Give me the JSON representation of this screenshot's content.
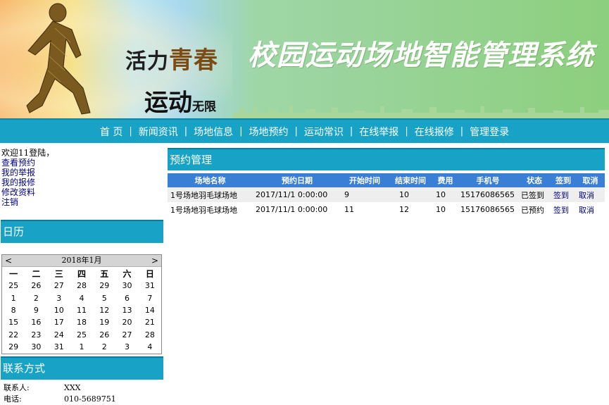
{
  "banner": {
    "slogan_line1_a": "活力",
    "slogan_line1_b": "青春",
    "slogan_line2": "运动",
    "slogan_line2_small": "无限",
    "system_title": "校园运动场地智能管理系统"
  },
  "nav": [
    "首 页",
    "新闻资讯",
    "场地信息",
    "场地预约",
    "运动常识",
    "在线举报",
    "在线报修",
    "管理登录"
  ],
  "sidebar": {
    "welcome": "欢迎11登陆，",
    "links": [
      "查看预约",
      "我的举报",
      "我的报修",
      "修改资料",
      "注销"
    ],
    "calendar_title": "日历",
    "contact_title": "联系方式"
  },
  "calendar": {
    "month_label": "2018年1月",
    "prev": "<",
    "next": ">",
    "weekdays": [
      "一",
      "二",
      "三",
      "四",
      "五",
      "六",
      "日"
    ],
    "weeks": [
      [
        "25",
        "26",
        "27",
        "28",
        "29",
        "30",
        "31"
      ],
      [
        "1",
        "2",
        "3",
        "4",
        "5",
        "6",
        "7"
      ],
      [
        "8",
        "9",
        "10",
        "11",
        "12",
        "13",
        "14"
      ],
      [
        "15",
        "16",
        "17",
        "18",
        "19",
        "20",
        "21"
      ],
      [
        "22",
        "23",
        "24",
        "25",
        "26",
        "27",
        "28"
      ],
      [
        "29",
        "30",
        "31",
        "1",
        "2",
        "3",
        "4"
      ]
    ]
  },
  "contact": {
    "contact_person_label": "联系人:",
    "contact_person": "XXX",
    "phone_label": "电话:",
    "phone": "010-5689751"
  },
  "booking": {
    "title": "预约管理",
    "columns": [
      "场地名称",
      "预约日期",
      "开始时间",
      "结束时间",
      "费用",
      "手机号",
      "状态",
      "签到",
      "取消"
    ],
    "rows": [
      {
        "venue": "1号场地羽毛球场地",
        "date": "2017/11/1 0:00:00",
        "start": "9",
        "end": "10",
        "fee": "10",
        "phone": "15176086565",
        "status": "已签到",
        "checkin": "签到",
        "cancel": "取消"
      },
      {
        "venue": "1号场地羽毛球场地",
        "date": "2017/11/1 0:00:00",
        "start": "11",
        "end": "12",
        "fee": "10",
        "phone": "15176086565",
        "status": "已预约",
        "checkin": "签到",
        "cancel": "取消"
      }
    ]
  },
  "colors": {
    "nav_bg": "#18a3c6",
    "table_header_bg": "#3a7fd6",
    "link": "#00008b",
    "banner_green": "#8ccf7d"
  }
}
